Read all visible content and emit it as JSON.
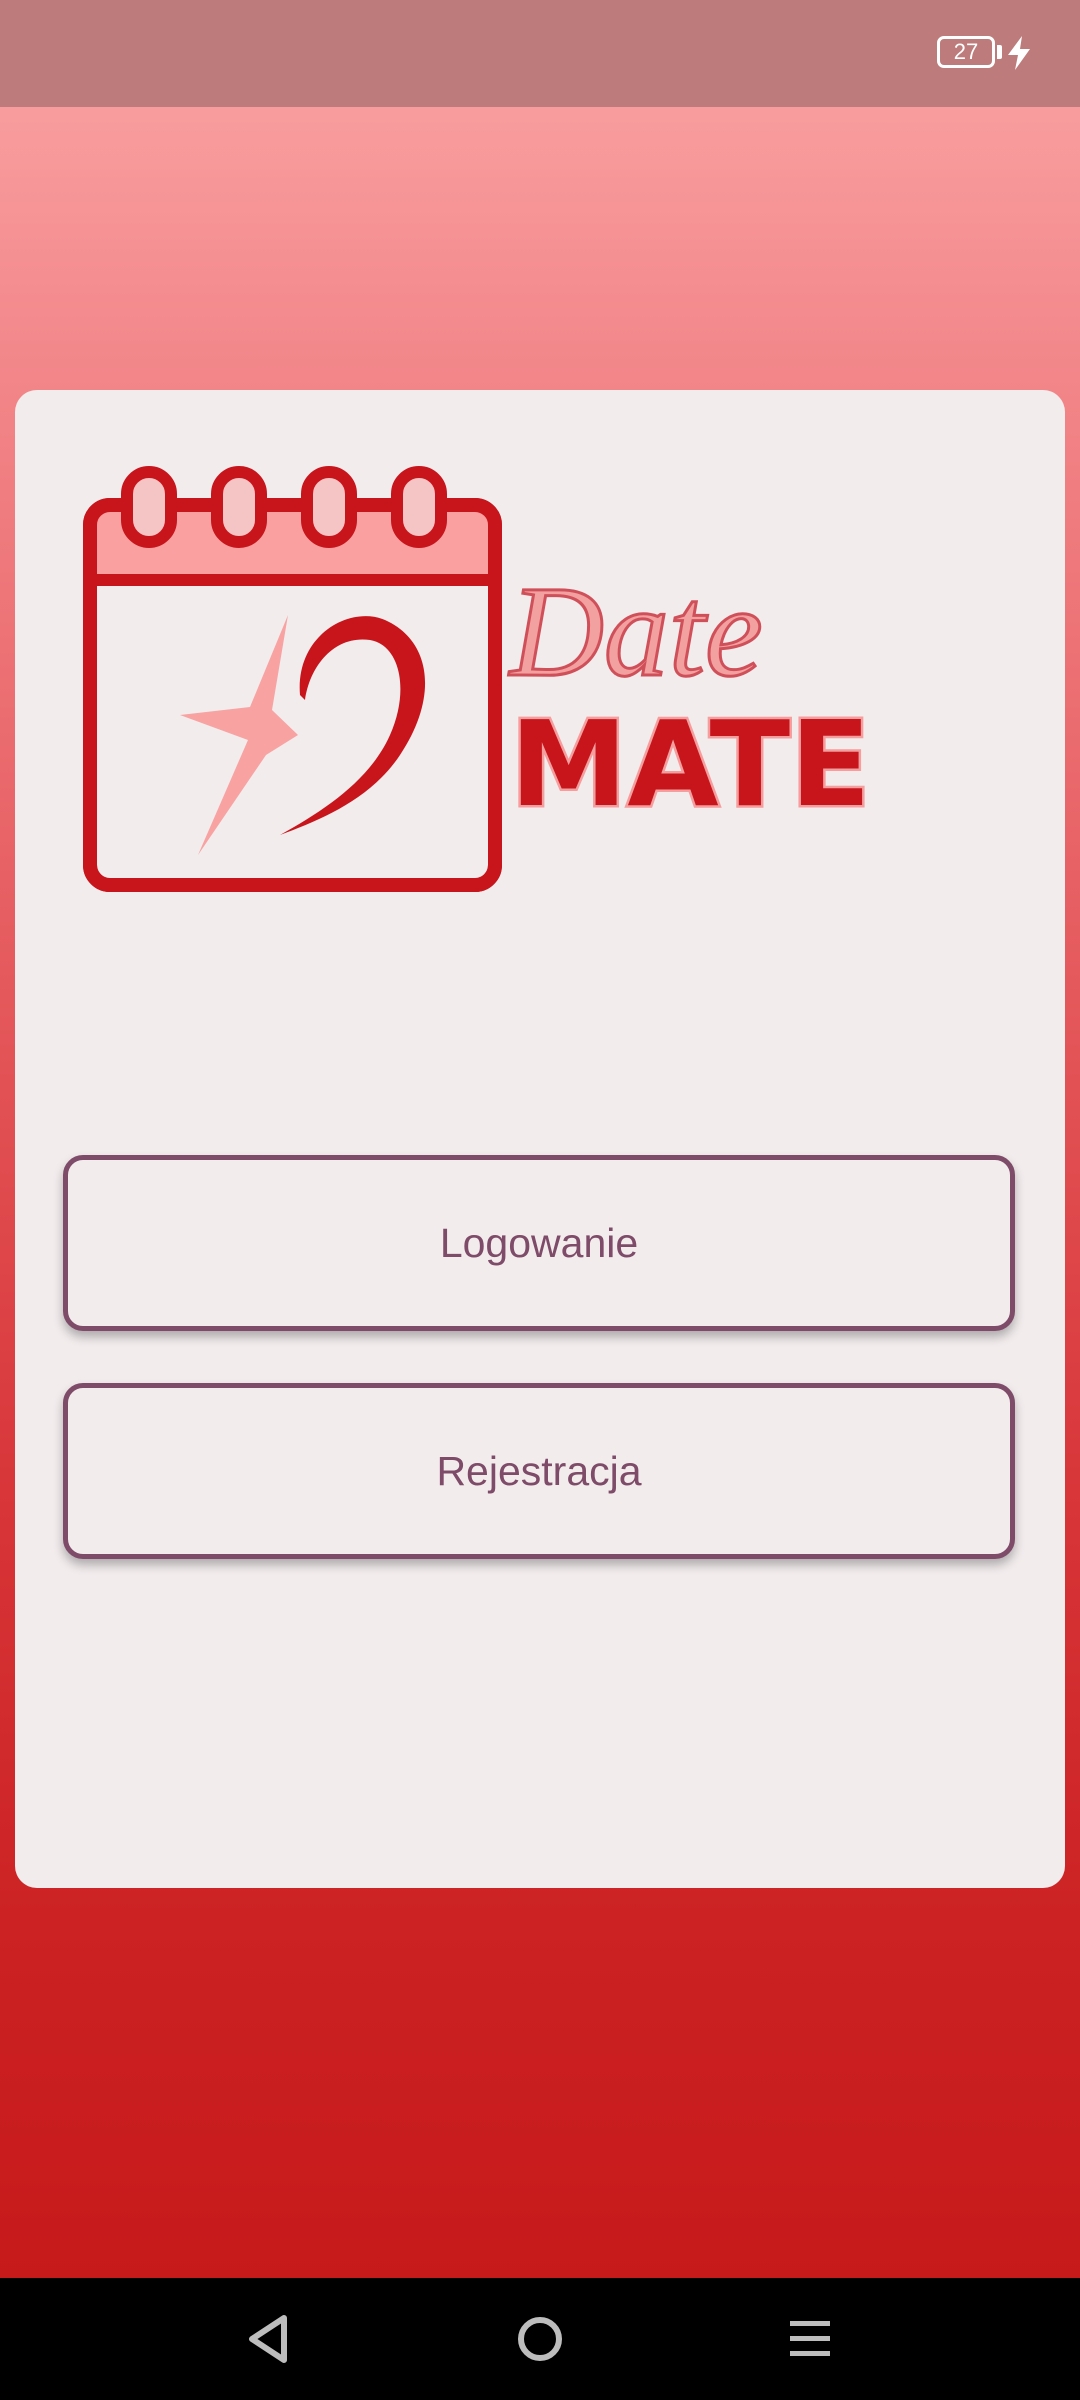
{
  "status_bar": {
    "battery_level": "27",
    "charging_icon": "lightning-bolt-icon"
  },
  "logo": {
    "word_top": "Date",
    "word_bottom": "MATE",
    "icon": "calendar-heart-logo"
  },
  "buttons": {
    "login_label": "Logowanie",
    "register_label": "Rejestracja"
  },
  "nav_bar": {
    "back_icon": "back-triangle-icon",
    "home_icon": "home-circle-icon",
    "menu_icon": "menu-lines-icon"
  },
  "colors": {
    "gradient_top": "#fba6a6",
    "gradient_bottom": "#c41617",
    "card_background": "#f2eced",
    "button_border": "#7e4b68",
    "logo_red": "#c8151c",
    "logo_pink": "#f59e9e"
  }
}
